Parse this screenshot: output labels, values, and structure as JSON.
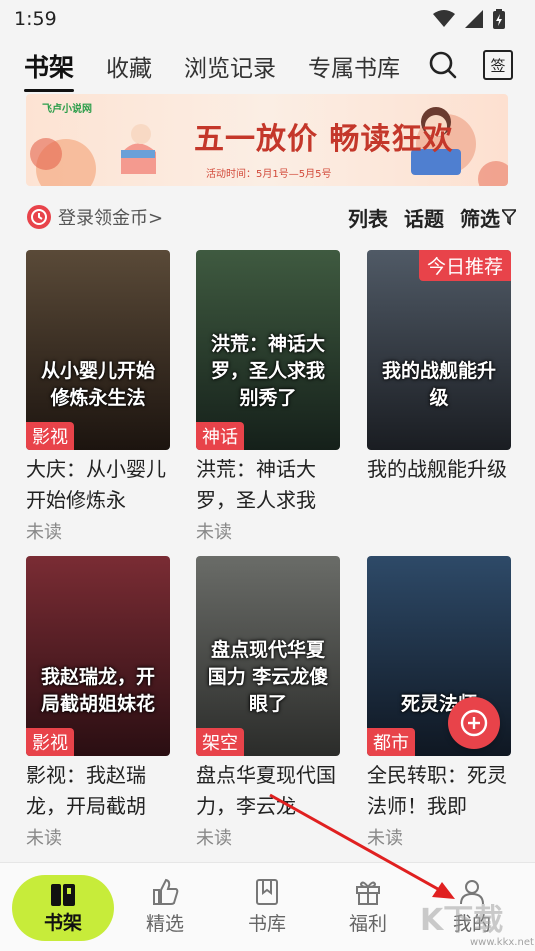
{
  "status_bar": {
    "time": "1:59"
  },
  "tabs": [
    {
      "label": "书架",
      "active": true
    },
    {
      "label": "收藏"
    },
    {
      "label": "浏览记录"
    },
    {
      "label": "专属书库"
    }
  ],
  "tab_icons": {
    "search": "search-icon",
    "checkin": "签"
  },
  "banner": {
    "logo": "飞卢小说网",
    "title": "五一放价 畅读狂欢",
    "subtitle": "活动时间：5月1号—5月5号"
  },
  "filter": {
    "login_coin": "登录领金币>",
    "list": "列表",
    "topic": "话题",
    "filter": "筛选"
  },
  "books": [
    {
      "cover_text": "从小婴儿开始修炼永生法",
      "tag": "影视",
      "title": "大庆：从小婴儿开始修炼永",
      "status": "未读",
      "colors": [
        "#5a4a38",
        "#1c140f"
      ]
    },
    {
      "cover_text": "洪荒：神话大罗，圣人求我别秀了",
      "tag": "神话",
      "title": "洪荒：神话大罗，圣人求我",
      "status": "未读",
      "colors": [
        "#3f5a40",
        "#15201a"
      ]
    },
    {
      "cover_text": "我的战舰能升级",
      "tag": "",
      "badge": "今日推荐",
      "title": "我的战舰能升级",
      "status": "",
      "colors": [
        "#505a66",
        "#1a1d22"
      ]
    },
    {
      "cover_text": "我赵瑞龙，开局截胡姐妹花",
      "tag": "影视",
      "title": "影视：我赵瑞龙，开局截胡",
      "status": "未读",
      "colors": [
        "#7a2c34",
        "#2a0e12"
      ]
    },
    {
      "cover_text": "盘点现代华夏国力 李云龙傻眼了",
      "tag": "架空",
      "title": "盘点华夏现代国力，李云龙",
      "status": "未读",
      "colors": [
        "#6a6c68",
        "#2b2c2a"
      ]
    },
    {
      "cover_text": "死灵法师",
      "tag": "都市",
      "title": "全民转职：死灵法师！我即",
      "status": "未读",
      "colors": [
        "#2e4a68",
        "#0f1722"
      ]
    }
  ],
  "fab": {
    "icon": "plus-icon"
  },
  "bottom_nav": [
    {
      "label": "书架",
      "icon": "bookshelf-icon",
      "active": true
    },
    {
      "label": "精选",
      "icon": "thumbs-up-icon"
    },
    {
      "label": "书库",
      "icon": "book-bookmark-icon"
    },
    {
      "label": "福利",
      "icon": "gift-icon"
    },
    {
      "label": "我的",
      "icon": "user-icon"
    }
  ],
  "watermark": {
    "text": "K下载",
    "url": "www.kkx.net"
  },
  "colors": {
    "accent_red": "#e8434a",
    "nav_active": "#c7ec3a"
  }
}
